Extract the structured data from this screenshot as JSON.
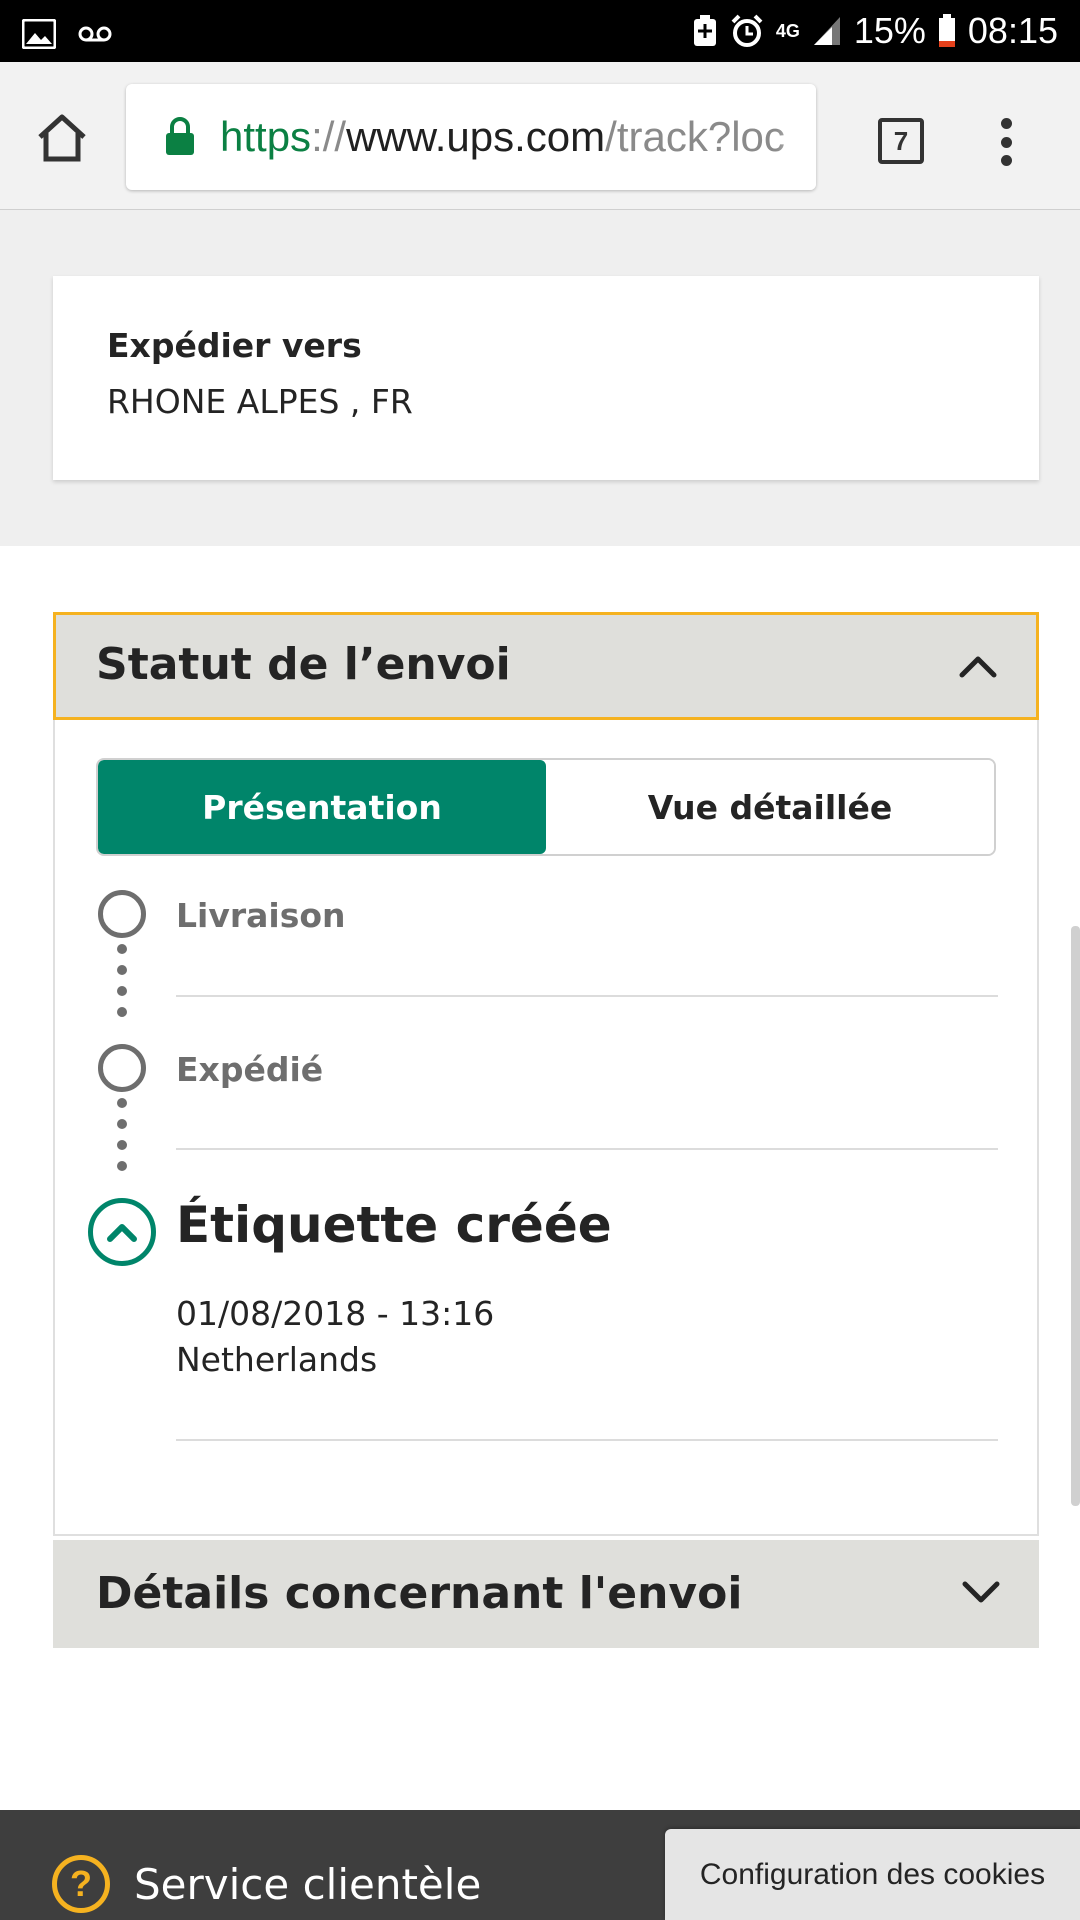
{
  "status_bar": {
    "battery": "15%",
    "time": "08:15",
    "network": "4G"
  },
  "browser": {
    "url_scheme": "https",
    "url_sep": "://",
    "url_host": "www.ups.com",
    "url_path": "/track?loc",
    "tab_count": "7"
  },
  "ship_to": {
    "label": "Expédier vers",
    "value": "RHONE ALPES , FR"
  },
  "status_section": {
    "title": "Statut de l’envoi",
    "tabs": [
      {
        "label": "Présentation",
        "active": true
      },
      {
        "label": "Vue détaillée",
        "active": false
      }
    ],
    "milestones": [
      {
        "label": "Livraison"
      },
      {
        "label": "Expédié"
      }
    ],
    "current": {
      "title": "Étiquette créée",
      "datetime": "01/08/2018 - 13:16",
      "location": "Netherlands"
    }
  },
  "details_section": {
    "title": "Détails concernant l'envoi"
  },
  "footer": {
    "help_icon": "?",
    "service_label": "Service clientèle",
    "cookie_button": "Configuration des cookies"
  },
  "colors": {
    "accent_green": "#00856a",
    "highlight_yellow": "#f5b220",
    "footer_bg": "#3e3e3e"
  }
}
